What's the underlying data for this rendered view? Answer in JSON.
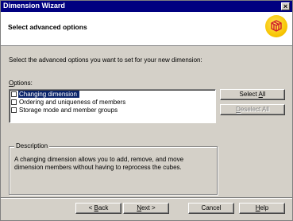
{
  "window": {
    "title": "Dimension Wizard",
    "close_glyph": "×"
  },
  "header": {
    "title": "Select advanced options",
    "logo_icon": "dimension-cube-icon"
  },
  "prompt": "Select the advanced options you want to set for your new dimension:",
  "options": {
    "label_accel": "O",
    "label_rest": "ptions:",
    "items": [
      {
        "label": "Changing dimension",
        "checked": false,
        "selected": true
      },
      {
        "label": "Ordering and uniqueness of members",
        "checked": false,
        "selected": false
      },
      {
        "label": "Storage mode and member groups",
        "checked": false,
        "selected": false
      }
    ]
  },
  "buttons": {
    "select_all": {
      "pre": "Select ",
      "accel": "A",
      "post": "ll"
    },
    "deselect_all": {
      "pre": "",
      "accel": "D",
      "post": "eselect All"
    },
    "back": {
      "pre": "< ",
      "accel": "B",
      "post": "ack"
    },
    "next": {
      "pre": "",
      "accel": "N",
      "post": "ext >"
    },
    "cancel": "Cancel",
    "help": {
      "pre": "",
      "accel": "H",
      "post": "elp"
    }
  },
  "description": {
    "legend": "Description",
    "text": "A changing dimension allows you to add, remove, and move dimension members without having to reprocess the cubes."
  },
  "colors": {
    "titlebar": "#000080",
    "selection": "#0a246a",
    "logo": "#f7c400",
    "logo_cube": "#d11f2a"
  }
}
